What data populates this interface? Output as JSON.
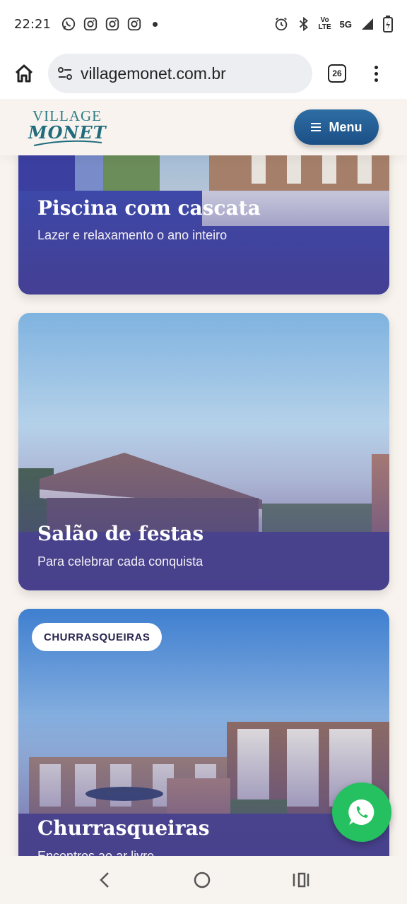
{
  "status_bar": {
    "time": "22:21",
    "network": "5G",
    "volte_line1": "Vo",
    "volte_line2": "LTE"
  },
  "browser": {
    "url": "villagemonet.com.br",
    "tab_count": "26"
  },
  "site": {
    "logo_line1": "VILLAGE",
    "logo_line2": "MONET",
    "menu_label": "Menu"
  },
  "cards": [
    {
      "title": "Piscina com cascata",
      "subtitle": "Lazer e relaxamento o ano inteiro"
    },
    {
      "title": "Salão de festas",
      "subtitle": "Para celebrar cada conquista"
    },
    {
      "tag": "CHURRASQUEIRAS",
      "title": "Churrasqueiras",
      "subtitle": "Encontros ao ar livre"
    }
  ],
  "colors": {
    "menu_button": "#1f5a92",
    "whatsapp": "#25c060",
    "card_overlay": "#463c8c",
    "page_bg": "#f8f3ee"
  }
}
